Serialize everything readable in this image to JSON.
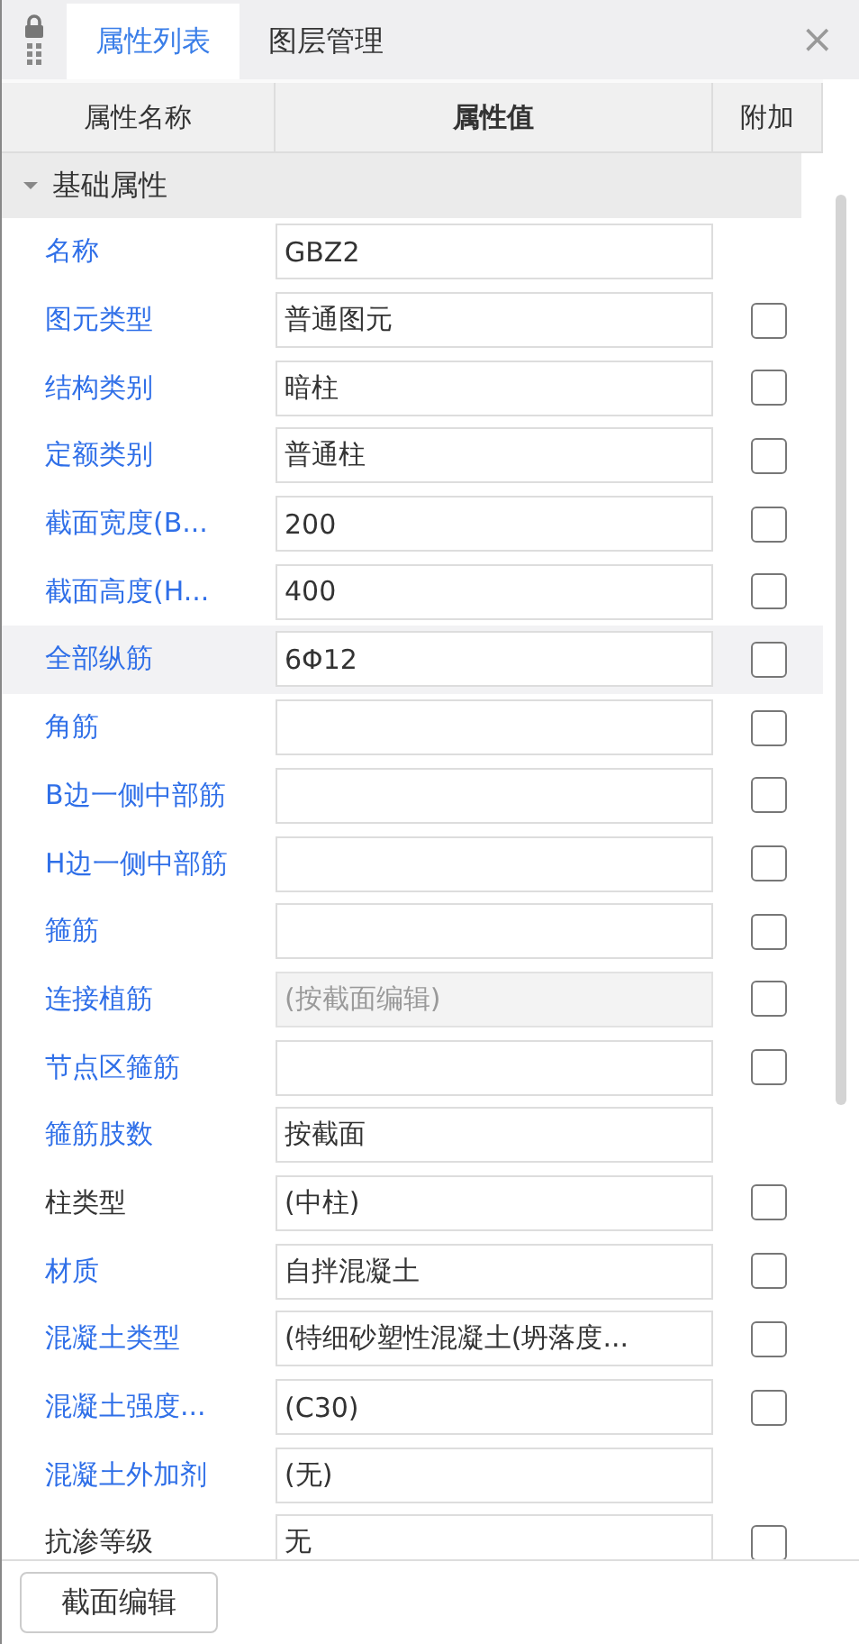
{
  "tabs": [
    {
      "label": "属性列表",
      "selected": true
    },
    {
      "label": "图层管理",
      "selected": false
    }
  ],
  "close": "×",
  "columns": [
    "属性名称",
    "属性值",
    "附加"
  ],
  "group": {
    "label": "基础属性",
    "expanded": true
  },
  "rows": [
    {
      "name": "名称",
      "color": "#2f6fe8",
      "value": "GBZ2",
      "selected": false,
      "disabled": false
    },
    {
      "name": "图元类型",
      "color": "#2f6fe8",
      "value": "普通图元",
      "selected": false,
      "disabled": false,
      "checked": false
    },
    {
      "name": "结构类别",
      "color": "#2f6fe8",
      "value": "暗柱",
      "selected": false,
      "disabled": false,
      "checked": false
    },
    {
      "name": "定额类别",
      "color": "#2f6fe8",
      "value": "普通柱",
      "selected": false,
      "disabled": false,
      "checked": false
    },
    {
      "name": "截面宽度(B...",
      "color": "#2f6fe8",
      "value": "200",
      "selected": false,
      "disabled": false,
      "checked": false
    },
    {
      "name": "截面高度(H...",
      "color": "#2f6fe8",
      "value": "400",
      "selected": false,
      "disabled": false,
      "checked": false
    },
    {
      "name": "全部纵筋",
      "color": "#2f6fe8",
      "value": "6Φ12",
      "selected": true,
      "disabled": false,
      "checked": false
    },
    {
      "name": "角筋",
      "color": "#2f6fe8",
      "value": "",
      "selected": false,
      "disabled": false,
      "checked": false
    },
    {
      "name": "B边一侧中部筋",
      "color": "#2f6fe8",
      "value": "",
      "selected": false,
      "disabled": false,
      "checked": false
    },
    {
      "name": "H边一侧中部筋",
      "color": "#2f6fe8",
      "value": "",
      "selected": false,
      "disabled": false,
      "checked": false
    },
    {
      "name": "箍筋",
      "color": "#2f6fe8",
      "value": "",
      "selected": false,
      "disabled": false,
      "checked": false
    },
    {
      "name": "连接植筋",
      "color": "#2f6fe8",
      "value": "(按截面编辑)",
      "selected": false,
      "disabled": true,
      "checked": false
    },
    {
      "name": "节点区箍筋",
      "color": "#2f6fe8",
      "value": "",
      "selected": false,
      "disabled": false,
      "checked": false
    },
    {
      "name": "箍筋肢数",
      "color": "#2f6fe8",
      "value": "按截面",
      "selected": false,
      "disabled": false
    },
    {
      "name": "柱类型",
      "color": "#333333",
      "value": "(中柱)",
      "selected": false,
      "disabled": false,
      "checked": false
    },
    {
      "name": "材质",
      "color": "#2f6fe8",
      "value": "自拌混凝土",
      "selected": false,
      "disabled": false,
      "checked": false
    },
    {
      "name": "混凝土类型",
      "color": "#2f6fe8",
      "value": "(特细砂塑性混凝土(坍落度...",
      "selected": false,
      "disabled": false,
      "checked": false
    },
    {
      "name": "混凝土强度...",
      "color": "#2f6fe8",
      "value": "(C30)",
      "selected": false,
      "disabled": false,
      "checked": false
    },
    {
      "name": "混凝土外加剂",
      "color": "#2f6fe8",
      "value": "(无)",
      "selected": false,
      "disabled": false
    },
    {
      "name": "抗渗等级",
      "color": "#333333",
      "value": "无",
      "selected": false,
      "disabled": false,
      "checked": false
    }
  ],
  "footer_button": "截面编辑"
}
